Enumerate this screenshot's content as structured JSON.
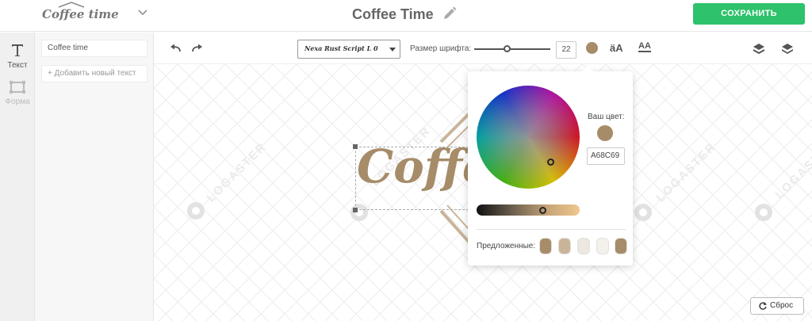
{
  "header": {
    "logo_text": "Coffee time",
    "project_title": "Coffee Time",
    "save_label": "СОХРАНИТЬ",
    "accent_color": "#2dc26b"
  },
  "tools": [
    {
      "label": "Текст",
      "icon": "text-tool-icon",
      "active": true
    },
    {
      "label": "Форма",
      "icon": "shape-tool-icon",
      "active": false
    }
  ],
  "text_panel": {
    "items": [
      "Coffee time"
    ],
    "add_label": "+ Добавить новый текст"
  },
  "toolbar": {
    "font_name": "Nexa Rust Script L 0",
    "size_label": "Размер шрифта:",
    "font_size": "22",
    "current_color": "#a68c69",
    "case_label": "äA",
    "underline_label": "AA"
  },
  "canvas": {
    "brand_text": "Coffe",
    "watermark": "LOGASTER",
    "reset_label": "Сброс"
  },
  "picker": {
    "your_color_label": "Ваш цвет:",
    "hex_value": "A68C69",
    "suggested_label": "Предложенные:",
    "suggested_colors": [
      "#a68c69",
      "#c9b49a",
      "#ece7e1",
      "#f4f1ed",
      "#a68c69"
    ]
  }
}
